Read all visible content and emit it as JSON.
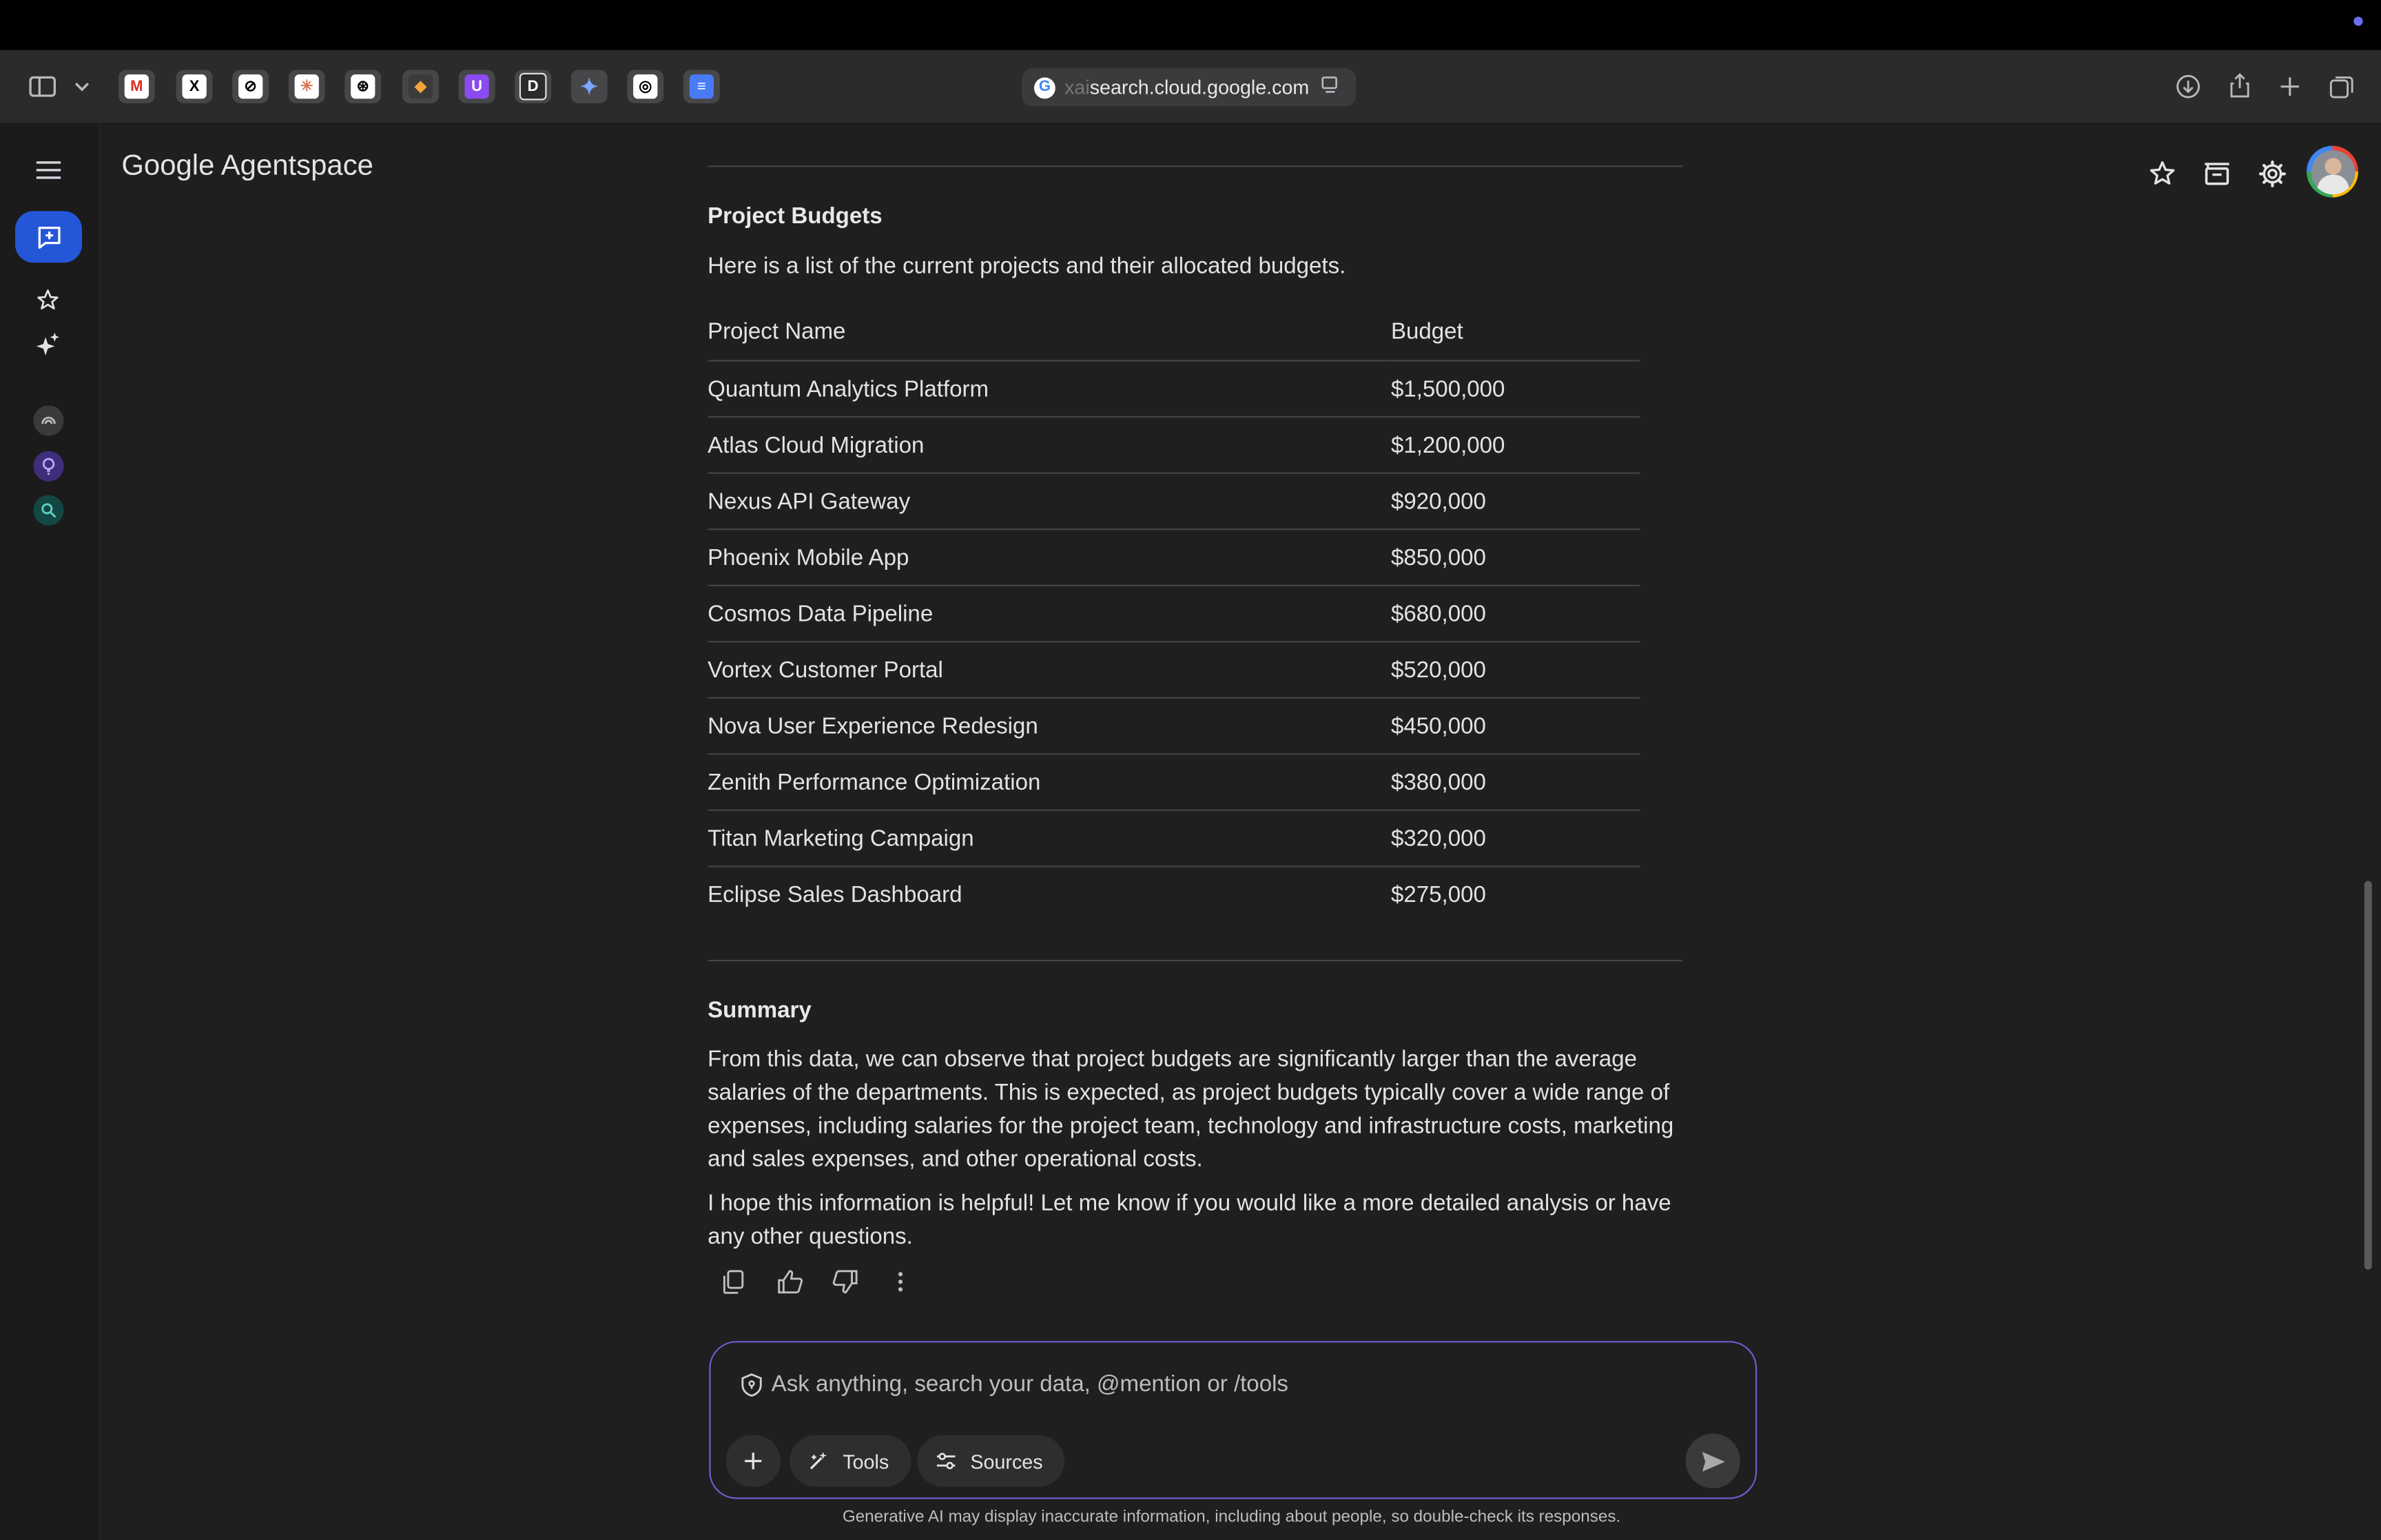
{
  "browser": {
    "url_prefix": "xai",
    "url_main": "search.cloud.google.com",
    "tabs": [
      "gmail",
      "x",
      "perplexity",
      "claude",
      "openai",
      "other",
      "u",
      "d",
      "gemini",
      "assistant",
      "docs"
    ]
  },
  "app": {
    "brand_google": "Google",
    "brand_product": "Agentspace"
  },
  "section_projects": {
    "title": "Project Budgets",
    "intro": "Here is a list of the current projects and their allocated budgets.",
    "columns": [
      "Project Name",
      "Budget"
    ],
    "rows": [
      {
        "name": "Quantum Analytics Platform",
        "budget": "$1,500,000"
      },
      {
        "name": "Atlas Cloud Migration",
        "budget": "$1,200,000"
      },
      {
        "name": "Nexus API Gateway",
        "budget": "$920,000"
      },
      {
        "name": "Phoenix Mobile App",
        "budget": "$850,000"
      },
      {
        "name": "Cosmos Data Pipeline",
        "budget": "$680,000"
      },
      {
        "name": "Vortex Customer Portal",
        "budget": "$520,000"
      },
      {
        "name": "Nova User Experience Redesign",
        "budget": "$450,000"
      },
      {
        "name": "Zenith Performance Optimization",
        "budget": "$380,000"
      },
      {
        "name": "Titan Marketing Campaign",
        "budget": "$320,000"
      },
      {
        "name": "Eclipse Sales Dashboard",
        "budget": "$275,000"
      }
    ]
  },
  "section_summary": {
    "title": "Summary",
    "paragraph1": "From this data, we can observe that project budgets are significantly larger than the average salaries of the departments. This is expected, as project budgets typically cover a wide range of expenses, including salaries for the project team, technology and infrastructure costs, marketing and sales expenses, and other operational costs.",
    "paragraph2": "I hope this information is helpful! Let me know if you would like a more detailed analysis or have any other questions."
  },
  "composer": {
    "placeholder": "Ask anything, search your data, @mention or /tools",
    "tools_label": "Tools",
    "sources_label": "Sources"
  },
  "disclaimer": "Generative AI may display inaccurate information, including about people, so double-check its responses.",
  "colors": {
    "background": "#1f1f1f",
    "accent": "#2456d8",
    "input_border": "#6b5fd2"
  }
}
